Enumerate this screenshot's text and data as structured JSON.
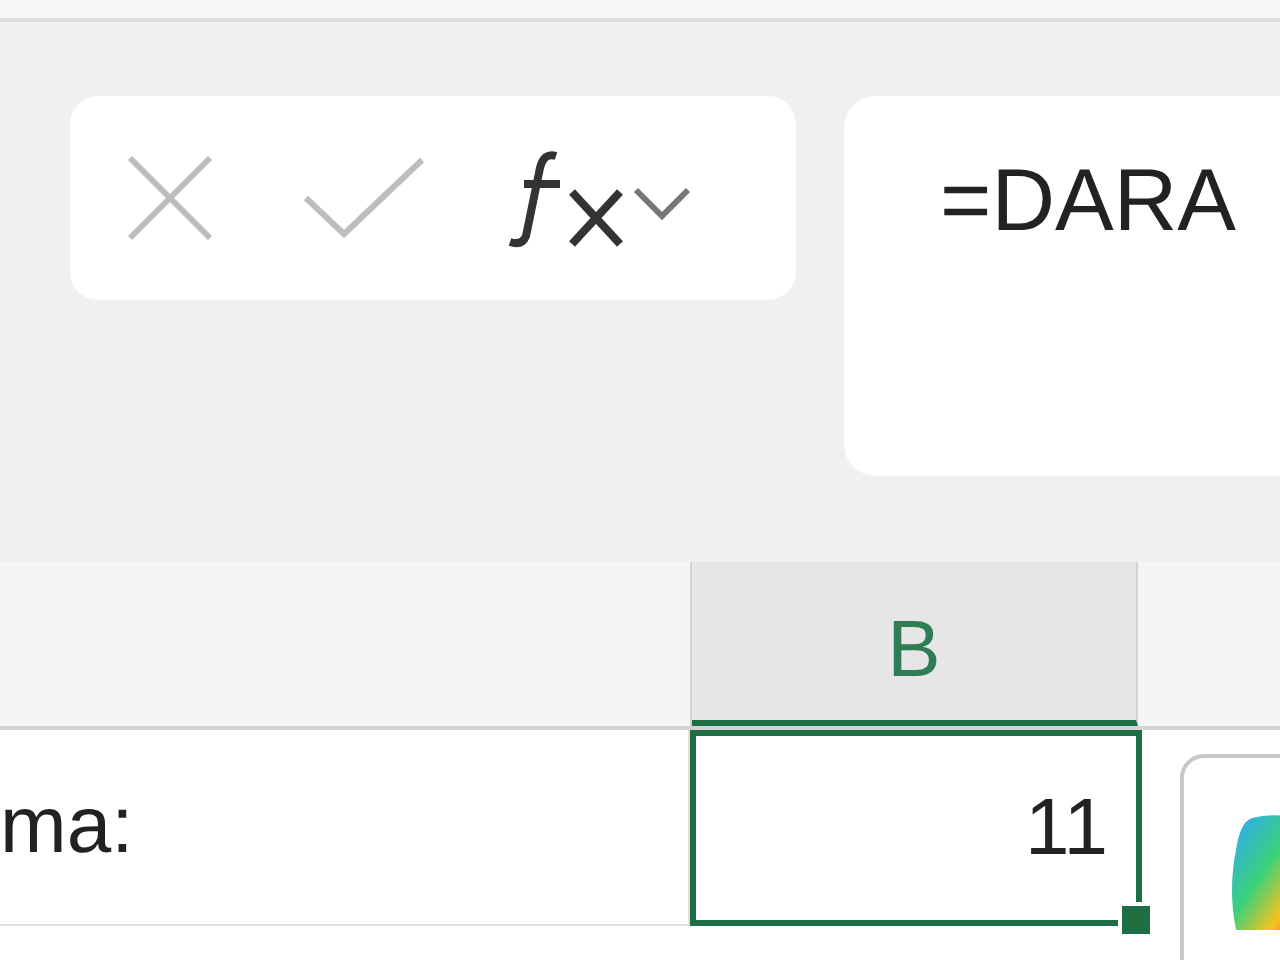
{
  "formula_bar": {
    "formula": "=DARA"
  },
  "columns": [
    {
      "label": "B",
      "selected": true
    }
  ],
  "cells": [
    {
      "text": "ma:",
      "selected": false
    },
    {
      "text": "11",
      "selected": true
    }
  ]
}
